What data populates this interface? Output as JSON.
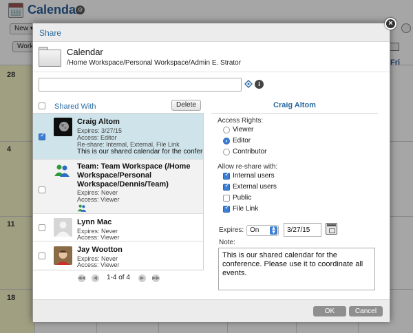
{
  "app": {
    "title": "Calendar",
    "toolbar": {
      "new_label": "New",
      "workweek_label": "Work"
    },
    "day_header": "Fri",
    "week_numbers": [
      "28",
      "4",
      "11",
      "18"
    ]
  },
  "dialog": {
    "title": "Share",
    "close_glyph": "×",
    "item": {
      "name": "Calendar",
      "path": "/Home Workspace/Personal Workspace/Admin E. Strator"
    },
    "search": {
      "value": "",
      "placeholder": ""
    },
    "icons": {
      "address_book": "address-book-icon",
      "info": "info-icon",
      "info_glyph": "i"
    },
    "list": {
      "header": "Shared With",
      "delete_label": "Delete",
      "rows": [
        {
          "name": "Craig Altom",
          "expires": "Expires: 3/27/15",
          "access": "Access: Editor",
          "reshare": "Re-share: Internal, External, File Link",
          "description": "This is our shared calendar for the confere...",
          "checked": true,
          "selected": true
        },
        {
          "name": "Team: Team Workspace (/Home Workspace/Personal Workspace/Dennis/Team)",
          "expires": "Expires: Never",
          "access": "Access: Viewer",
          "checked": false
        },
        {
          "name": "Lynn Mac",
          "expires": "Expires: Never",
          "access": "Access: Viewer",
          "checked": false
        },
        {
          "name": "Jay Wootton",
          "expires": "Expires: Never",
          "access": "Access: Viewer",
          "checked": false
        }
      ],
      "pager": {
        "text": "1-4 of 4",
        "first": "◀◀",
        "prev": "◀",
        "next": "▶",
        "last": "▶▶"
      }
    },
    "detail": {
      "name": "Craig Altom",
      "access_rights_label": "Access Rights:",
      "access_options": [
        "Viewer",
        "Editor",
        "Contributor"
      ],
      "access_selected": "Editor",
      "reshare_label": "Allow re-share with:",
      "reshare_options": [
        {
          "label": "Internal users",
          "checked": true
        },
        {
          "label": "External users",
          "checked": true
        },
        {
          "label": "Public",
          "checked": false
        },
        {
          "label": "File Link",
          "checked": true
        }
      ],
      "expires_label": "Expires:",
      "expires_select": "On",
      "expires_date": "3/27/15",
      "note_label": "Note:",
      "note": "This is our shared calendar for the conference. Please use it to coordinate all events."
    },
    "footer": {
      "ok_label": "OK",
      "cancel_label": "Cancel"
    }
  },
  "colors": {
    "accent": "#2b6aa0",
    "selection": "#cfe4ea",
    "checkbox_on": "#3c7fd5",
    "weekend": "#f6f4c8"
  }
}
